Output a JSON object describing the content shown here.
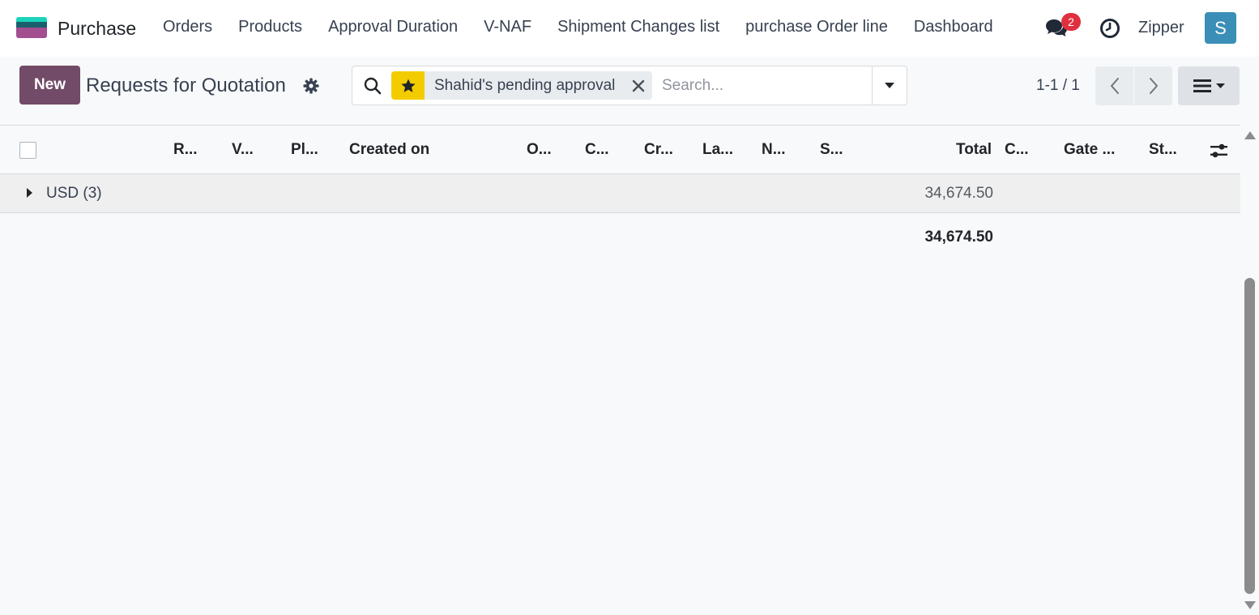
{
  "navbar": {
    "app_name": "Purchase",
    "menu": [
      "Orders",
      "Products",
      "Approval Duration",
      "V-NAF",
      "Shipment Changes list",
      "purchase Order line",
      "Dashboard"
    ],
    "messages_badge": "2",
    "company": "Zipper",
    "avatar_initial": "S",
    "colors": {
      "badge": "#e0303f",
      "avatar": "#3b8fb7"
    }
  },
  "control_panel": {
    "new_label": "New",
    "title": "Requests for Quotation",
    "search": {
      "facet_label": "Shahid's pending approval",
      "placeholder": "Search...",
      "value": ""
    },
    "pager": "1-1 / 1",
    "colors": {
      "new_button": "#714b67",
      "facet_star": "#f3cc00"
    }
  },
  "list": {
    "columns": [
      "R...",
      "V...",
      "Pl...",
      "Created on",
      "O...",
      "C...",
      "Cr...",
      "La...",
      "N...",
      "S...",
      "Total",
      "C...",
      "Gate ...",
      "St..."
    ],
    "groups": [
      {
        "label": "USD (3)",
        "total": "34,674.50"
      }
    ],
    "grand_total": "34,674.50"
  }
}
